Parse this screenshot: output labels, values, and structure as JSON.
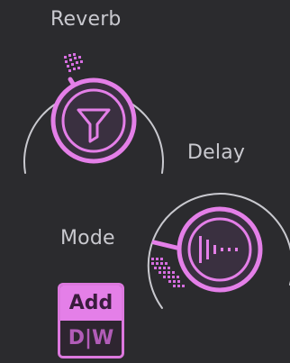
{
  "reverb": {
    "label": "Reverb",
    "icon": "filter-funnel-icon"
  },
  "delay": {
    "label": "Delay",
    "icon": "delay-taps-icon"
  },
  "mode": {
    "label": "Mode",
    "options": [
      "Add",
      "D|W"
    ],
    "selected": "Add"
  },
  "colors": {
    "background": "#2b2b2e",
    "accent": "#e47fe8",
    "knob_fill": "#3a3040",
    "arc": "#c9c9cf",
    "text": "#c9c9cf"
  }
}
